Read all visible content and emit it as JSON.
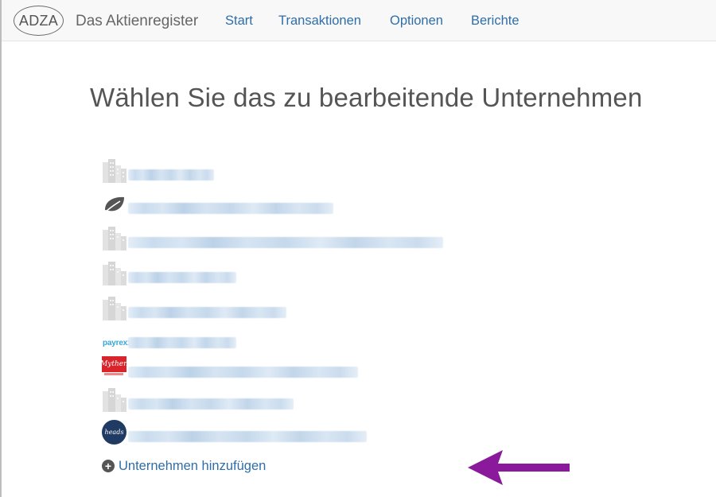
{
  "navbar": {
    "logo_text": "ADZA",
    "brand": "Das Aktienregister",
    "links": [
      {
        "label": "Start"
      },
      {
        "label": "Transaktionen"
      },
      {
        "label": "Optionen"
      },
      {
        "label": "Berichte"
      }
    ]
  },
  "page": {
    "title": "Wählen Sie das zu bearbeitende Unternehmen"
  },
  "companies": [
    {
      "logo": "building-placeholder-icon",
      "name_redacted": true
    },
    {
      "logo": "leaf-icon",
      "name_redacted": true
    },
    {
      "logo": "building-placeholder-icon",
      "name_redacted": true
    },
    {
      "logo": "building-placeholder-icon",
      "name_redacted": true
    },
    {
      "logo": "building-placeholder-icon",
      "name_redacted": true
    },
    {
      "logo": "payrexx-logo",
      "logo_text": "payrexx",
      "name_redacted": true
    },
    {
      "logo": "mythen-logo",
      "logo_text": "Mythen",
      "name_redacted": true
    },
    {
      "logo": "building-placeholder-icon",
      "name_redacted": true
    },
    {
      "logo": "headquarter-logo",
      "logo_text": "heads",
      "name_redacted": true
    }
  ],
  "actions": {
    "add_company": "Unternehmen hinzufügen",
    "add_icon": "plus-circle-icon"
  },
  "colors": {
    "link": "#2f6ea8",
    "text": "#555555",
    "arrow": "#8a1a9b",
    "navbar_bg": "#f8f8f8"
  }
}
